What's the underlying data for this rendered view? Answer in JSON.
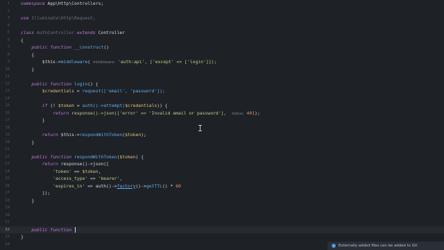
{
  "editor": {
    "lines": [
      {
        "n": "1",
        "t": ""
      },
      {
        "n": "2",
        "t": ""
      },
      {
        "n": "3",
        "t": ""
      },
      {
        "n": "4",
        "t": ""
      },
      {
        "n": "5",
        "t": ""
      },
      {
        "n": "6",
        "t": ""
      },
      {
        "n": "7",
        "t": ""
      },
      {
        "n": "8",
        "t": ""
      },
      {
        "n": "9",
        "t": ""
      },
      {
        "n": "10",
        "t": ""
      },
      {
        "n": "11",
        "t": ""
      },
      {
        "n": "12",
        "t": ""
      },
      {
        "n": "13",
        "t": ""
      },
      {
        "n": "14",
        "t": ""
      },
      {
        "n": "15",
        "t": ""
      },
      {
        "n": "16",
        "t": ""
      },
      {
        "n": "17",
        "t": ""
      },
      {
        "n": "18",
        "t": ""
      },
      {
        "n": "19",
        "t": ""
      },
      {
        "n": "20",
        "t": ""
      },
      {
        "n": "21",
        "t": ""
      },
      {
        "n": "22",
        "t": ""
      },
      {
        "n": "23",
        "t": ""
      },
      {
        "n": "24",
        "t": ""
      },
      {
        "n": "25",
        "t": ""
      },
      {
        "n": "26",
        "t": ""
      },
      {
        "n": "27",
        "t": ""
      },
      {
        "n": "28",
        "t": ""
      },
      {
        "n": "29",
        "t": ""
      },
      {
        "n": "30",
        "t": ""
      },
      {
        "n": "31",
        "t": ""
      },
      {
        "n": "32",
        "t": ""
      },
      {
        "n": "33",
        "t": ""
      },
      {
        "n": "34",
        "t": ""
      }
    ],
    "code": {
      "namespace_kw": "namespace",
      "namespace_val": "App\\Http\\Controllers;",
      "use_kw": "use",
      "use_val": "Illuminate\\Http\\Request;",
      "class_kw": "class",
      "class_name": "AuthController",
      "extends_kw": "extends",
      "parent": "Controller",
      "public_kw": "public",
      "function_kw": "function",
      "construct": "__construct",
      "this_mw": "$this",
      "middleware_fn": "middleware",
      "mw_hint": "middleware:",
      "mw_args": "'auth:api', ['except' => ['login']]);",
      "login_fn": "login",
      "credentials": "$credentials",
      "request_call": "request(['email', 'password']);",
      "if_kw": "if",
      "token_var": "$token",
      "auth_attempt": "auth()->attempt(",
      "return_kw": "return",
      "response_json_err": "response()->json(['error' => 'Invalid email or password'],",
      "status_hint": "status:",
      "status_code": "401",
      "respond_call": "respondWithToken",
      "respond_fn": "respondWithToken",
      "token_key": "'token'",
      "access_key": "'access_type'",
      "bearer_val": "'bearer'",
      "expires_key": "'expires_in'",
      "factory": "factory",
      "getttl": "getTTL",
      "sixty": "60"
    }
  },
  "notification": {
    "icon": "info-icon",
    "text": "Externally added files can be added to Git"
  }
}
